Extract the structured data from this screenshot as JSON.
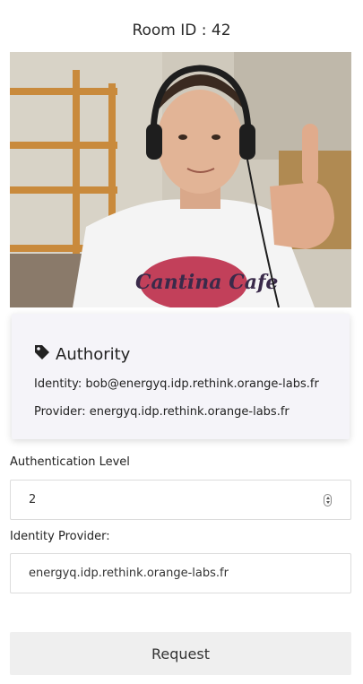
{
  "header": {
    "title": "Room ID : 42"
  },
  "video": {
    "image": "webcam-participant-thumbs-up"
  },
  "authority_card": {
    "icon": "tag-icon",
    "title": "Authority",
    "identity_line": "Identity: bob@energyq.idp.rethink.orange-labs.fr",
    "provider_line": "Provider: energyq.idp.rethink.orange-labs.fr"
  },
  "form": {
    "auth_level_label": "Authentication Level",
    "auth_level_value": "2",
    "idp_label": "Identity Provider:",
    "idp_value": "energyq.idp.rethink.orange-labs.fr",
    "request_label": "Request"
  }
}
